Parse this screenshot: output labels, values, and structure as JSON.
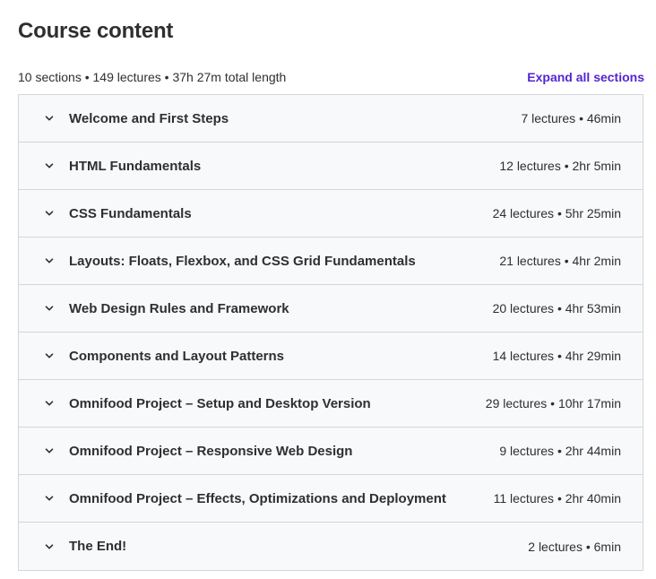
{
  "header": {
    "title": "Course content",
    "summary": "10 sections • 149 lectures • 37h 27m total length",
    "expand_all_label": "Expand all sections"
  },
  "colors": {
    "link": "#5624d0",
    "text": "#2d2f31",
    "section_bg": "#f7f9fa",
    "border": "#d1d7dc"
  },
  "icons": {
    "section_toggle": "chevron-down-icon"
  },
  "sections": [
    {
      "title": "Welcome and First Steps",
      "meta": "7 lectures • 46min"
    },
    {
      "title": "HTML Fundamentals",
      "meta": "12 lectures • 2hr 5min"
    },
    {
      "title": "CSS Fundamentals",
      "meta": "24 lectures • 5hr 25min"
    },
    {
      "title": "Layouts: Floats, Flexbox, and CSS Grid Fundamentals",
      "meta": "21 lectures • 4hr 2min"
    },
    {
      "title": "Web Design Rules and Framework",
      "meta": "20 lectures • 4hr 53min"
    },
    {
      "title": "Components and Layout Patterns",
      "meta": "14 lectures • 4hr 29min"
    },
    {
      "title": "Omnifood Project – Setup and Desktop Version",
      "meta": "29 lectures • 10hr 17min"
    },
    {
      "title": "Omnifood Project – Responsive Web Design",
      "meta": "9 lectures • 2hr 44min"
    },
    {
      "title": "Omnifood Project – Effects, Optimizations and Deployment",
      "meta": "11 lectures • 2hr 40min"
    },
    {
      "title": "The End!",
      "meta": "2 lectures • 6min"
    }
  ]
}
